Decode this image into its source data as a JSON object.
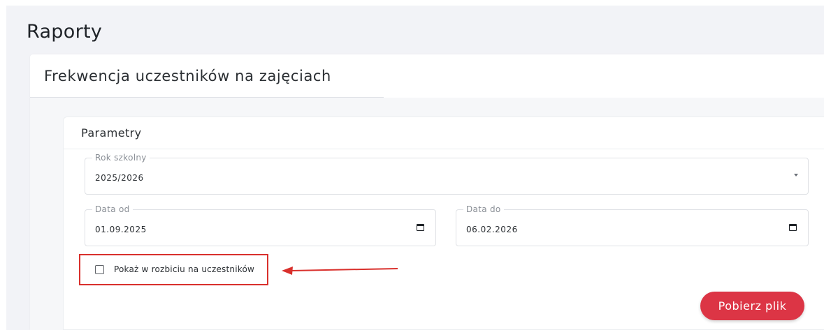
{
  "page": {
    "title": "Raporty"
  },
  "report": {
    "title": "Frekwencja uczestników na zajęciach"
  },
  "parameters": {
    "title": "Parametry",
    "school_year": {
      "label": "Rok szkolny",
      "value": "2025/2026",
      "icon": "chevron-down-icon"
    },
    "date_from": {
      "label": "Data od",
      "value": "01.09.2025",
      "icon": "calendar-icon"
    },
    "date_to": {
      "label": "Data do",
      "value": "06.02.2026",
      "icon": "calendar-icon"
    },
    "breakdown_checkbox": {
      "label": "Pokaż w rozbiciu na uczestników",
      "checked": false
    }
  },
  "actions": {
    "download_label": "Pobierz plik"
  },
  "annotation": {
    "highlight_color": "#d9302c",
    "arrow": "arrow-left-icon"
  },
  "colors": {
    "accent": "#dc3545",
    "background": "#f2f3f7"
  }
}
